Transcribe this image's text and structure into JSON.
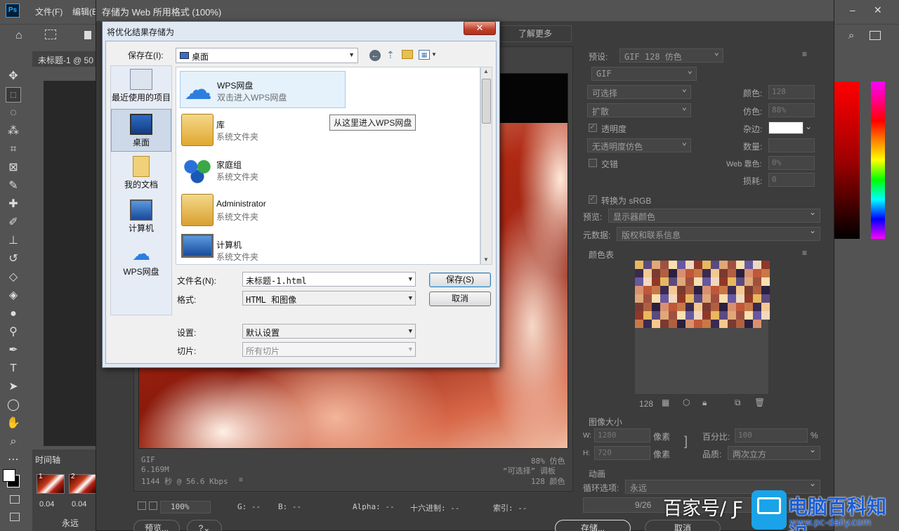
{
  "photoshop": {
    "logo": "Ps",
    "menus": [
      "文件(F)",
      "编辑(E"
    ],
    "doc_tab": "未标题-1 @ 50",
    "timeline_tab": "时间轴",
    "frames": [
      {
        "num": "1",
        "duration": "0.04"
      },
      {
        "num": "2",
        "duration": "0.04"
      }
    ],
    "loop": "永远",
    "tools": [
      "move-icon",
      "marquee-icon",
      "lasso-icon",
      "magic-wand-icon",
      "crop-icon",
      "frame-icon",
      "eyedropper-icon",
      "healing-icon",
      "brush-icon",
      "stamp-icon",
      "history-brush-icon",
      "eraser-icon",
      "bucket-icon",
      "blur-icon",
      "dodge-icon",
      "pen-icon",
      "type-icon",
      "path-select-icon",
      "ellipse-icon",
      "hand-icon",
      "zoom-icon",
      "more-icon"
    ]
  },
  "sfw": {
    "title": "存储为 Web 所用格式 (100%)",
    "learn_more": "了解更多",
    "preview_info": {
      "left": [
        "GIF",
        "6.169M",
        "1144 秒 @ 56.6 Kbps"
      ],
      "right": [
        "88% 仿色",
        "“可选择” 调板",
        "128 颜色"
      ]
    },
    "status": {
      "zoom": "100%",
      "g": "G: --",
      "b": "B: --",
      "alpha": "Alpha: --",
      "hex": "十六进制: --",
      "index": "索引: --"
    },
    "bottom": {
      "preview": "预览...",
      "save": "存储...",
      "cancel": "取消"
    },
    "settings": {
      "preset_label": "预设:",
      "preset_value": "GIF 128 仿色",
      "format": "GIF",
      "reduction": "可选择",
      "dither_algo": "扩散",
      "transparency_label": "透明度",
      "transparency_dither": "无透明度仿色",
      "interlaced_label": "交错",
      "colors_label": "颜色:",
      "colors_value": "128",
      "dither_label": "仿色:",
      "dither_value": "88%",
      "matte_label": "杂边:",
      "amount_label": "数量:",
      "web_snap_label": "Web 靠色:",
      "web_snap_value": "0%",
      "lossy_label": "损耗:",
      "lossy_value": "0",
      "convert_srgb": "转换为 sRGB",
      "preview_label": "预览:",
      "preview_value": "显示器颜色",
      "metadata_label": "元数据:",
      "metadata_value": "版权和联系信息",
      "color_table_label": "颜色表",
      "color_count": "128",
      "image_size_label": "图像大小",
      "w_label": "W:",
      "w_value": "1280",
      "h_label": "H:",
      "h_value": "720",
      "px": "像素",
      "percent_label": "百分比:",
      "percent_value": "100",
      "percent_unit": "%",
      "quality_label": "品质:",
      "quality_value": "两次立方",
      "animation_label": "动画",
      "loop_label": "循环选项:",
      "loop_value": "永远",
      "frame_counter": "9/26"
    }
  },
  "dialog": {
    "title": "将优化结果存储为",
    "save_in_label": "保存在(I):",
    "save_in_value": "桌面",
    "places": [
      "最近使用的项目",
      "桌面",
      "我的文档",
      "计算机",
      "WPS网盘"
    ],
    "items": [
      {
        "name": "WPS网盘",
        "sub": "双击进入WPS网盘"
      },
      {
        "name": "库",
        "sub": "系统文件夹"
      },
      {
        "name": "家庭组",
        "sub": "系统文件夹"
      },
      {
        "name": "Administrator",
        "sub": "系统文件夹"
      },
      {
        "name": "计算机",
        "sub": "系统文件夹"
      }
    ],
    "tooltip": "从这里进入WPS网盘",
    "filename_label": "文件名(N):",
    "filename_value": "未标题-1.html",
    "format_label": "格式:",
    "format_value": "HTML 和图像",
    "settings_label": "设置:",
    "settings_value": "默认设置",
    "slices_label": "切片:",
    "slices_value": "所有切片",
    "save_btn": "保存(S)",
    "cancel_btn": "取消"
  },
  "watermark": {
    "text": "百家号/ Ƒ",
    "brand": "电脑百科知识",
    "url": "www.pc-daily.com"
  }
}
